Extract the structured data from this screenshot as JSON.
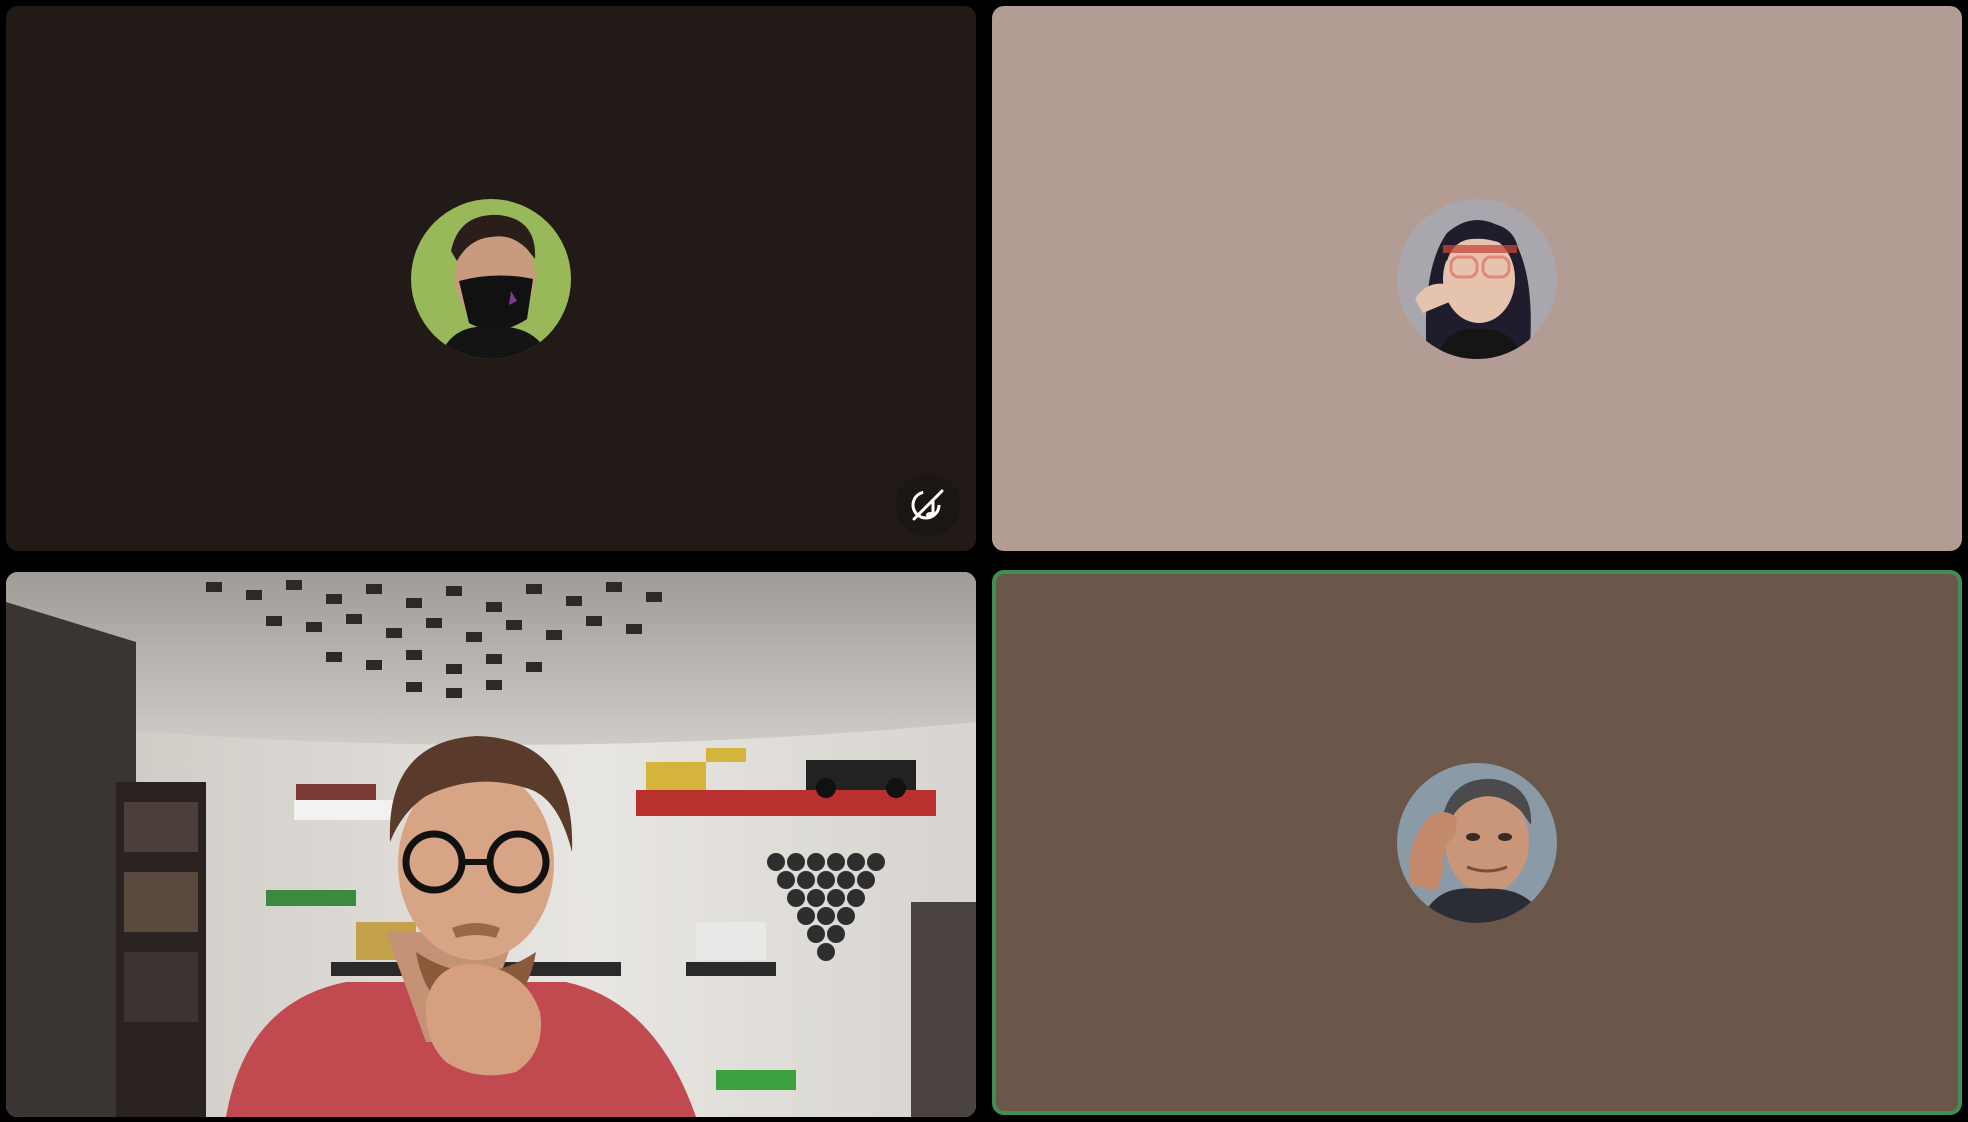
{
  "participants": [
    {
      "id": "p1",
      "video_on": false,
      "tile_color": "#221a17",
      "avatar_icon": "avatar-masked-man",
      "muted": true,
      "mute_icon": "mic-off-icon",
      "speaking": false
    },
    {
      "id": "p2",
      "video_on": false,
      "tile_color": "#b29c94",
      "avatar_icon": "avatar-woman-glasses",
      "muted": false,
      "speaking": false
    },
    {
      "id": "p3",
      "video_on": true,
      "tile_color": "#d9d6d1",
      "muted": false,
      "speaking": false
    },
    {
      "id": "p4",
      "video_on": false,
      "tile_color": "#6b5749",
      "avatar_icon": "avatar-man-hand-forehead",
      "muted": false,
      "speaking": true,
      "speaking_border_color": "#3f8f55"
    }
  ]
}
